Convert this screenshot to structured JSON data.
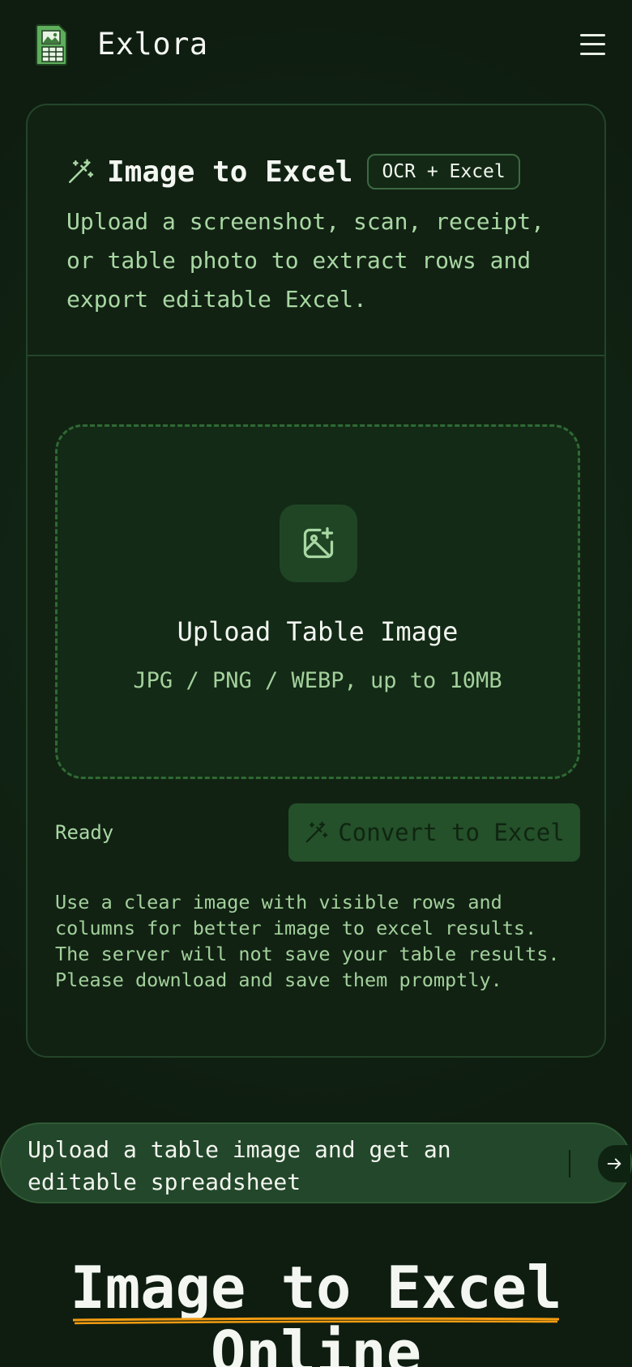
{
  "header": {
    "brand": "Exlora",
    "logo_icon": "spreadsheet-image-icon",
    "menu_icon": "hamburger-menu-icon"
  },
  "card": {
    "title": "Image to Excel",
    "badge": "OCR + Excel",
    "description": "Upload a screenshot, scan, receipt, or table photo to extract rows and export editable Excel.",
    "dropzone": {
      "title": "Upload Table Image",
      "subtitle": "JPG / PNG / WEBP, up to 10MB",
      "icon": "image-plus-icon"
    },
    "status": "Ready",
    "convert_label": "Convert to Excel",
    "hint": "Use a clear image with visible rows and columns for better image to excel results. The server will not save your table results. Please download and save them promptly."
  },
  "prompt": {
    "text": "Upload a table image and get an editable spreadsheet",
    "send_icon": "arrow-right-icon"
  },
  "hero": {
    "title": "Image to Excel Online"
  },
  "colors": {
    "background": "#0f1f12",
    "accent_text": "#a9d7a3",
    "button_bg": "#24502a",
    "underline": "#f39c12"
  }
}
